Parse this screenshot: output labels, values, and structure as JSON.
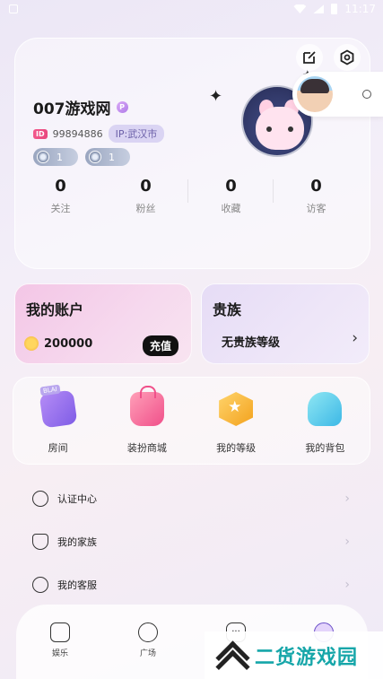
{
  "status_bar": {
    "time": "11:17"
  },
  "profile": {
    "username": "007游戏网",
    "name_badge": "P",
    "id_tag": "ID",
    "user_id": "99894886",
    "ip_location": "IP:武汉市",
    "levels": [
      "1",
      "1"
    ],
    "stats": [
      {
        "value": "0",
        "label": "关注"
      },
      {
        "value": "0",
        "label": "粉丝"
      },
      {
        "value": "0",
        "label": "收藏"
      },
      {
        "value": "0",
        "label": "访客"
      }
    ]
  },
  "account": {
    "title": "我的账户",
    "balance": "200000",
    "recharge_label": "充值"
  },
  "noble": {
    "title": "贵族",
    "status": "无贵族等级"
  },
  "features": [
    {
      "label": "房间",
      "icon": "room-icon"
    },
    {
      "label": "装扮商城",
      "icon": "shopping-bag-icon"
    },
    {
      "label": "我的等级",
      "icon": "level-star-icon"
    },
    {
      "label": "我的背包",
      "icon": "backpack-icon"
    }
  ],
  "menu": [
    {
      "label": "认证中心",
      "icon": "certification-icon"
    },
    {
      "label": "我的家族",
      "icon": "family-shield-icon"
    },
    {
      "label": "我的客服",
      "icon": "headset-icon"
    }
  ],
  "bottom_nav": [
    {
      "label": "娱乐",
      "icon": "entertainment-icon"
    },
    {
      "label": "广场",
      "icon": "planet-icon"
    },
    {
      "label": "",
      "icon": "chat-icon"
    },
    {
      "label": "",
      "icon": "me-icon"
    }
  ],
  "watermark": {
    "text": "二货游戏园"
  },
  "colors": {
    "accent_pink": "#e8477e",
    "coin_gold": "#f0a83a",
    "watermark_teal": "#16a6a9"
  }
}
